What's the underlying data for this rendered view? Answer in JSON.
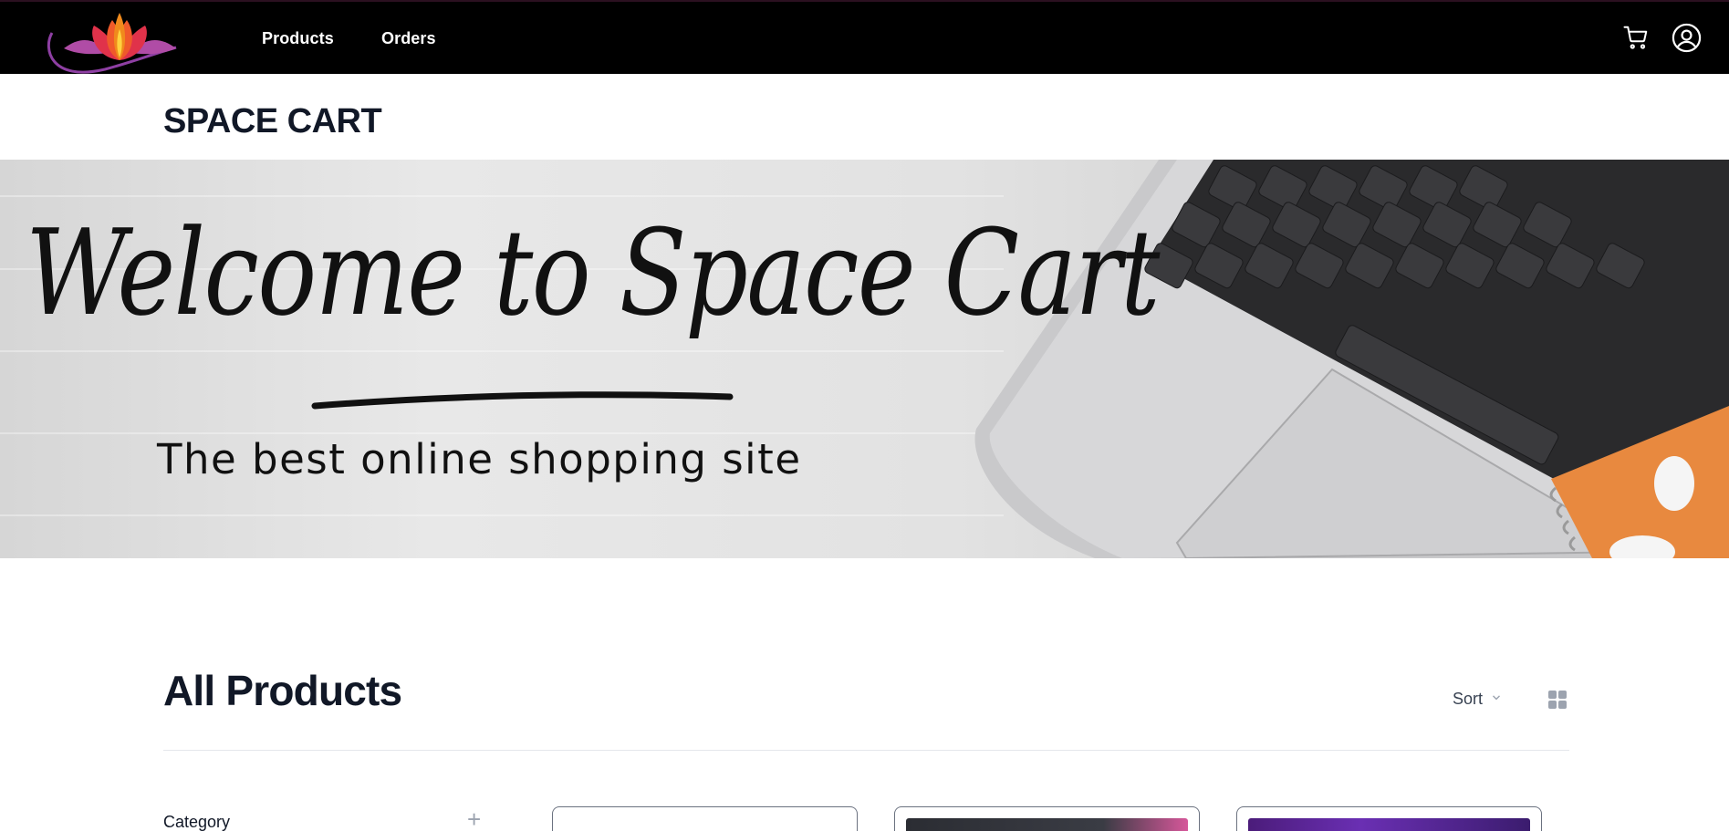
{
  "nav": {
    "logo": "lotus-logo",
    "links": [
      "Products",
      "Orders"
    ],
    "icons": [
      "cart-icon",
      "user-account-icon"
    ]
  },
  "brand": {
    "title": "SPACE CART"
  },
  "banner": {
    "headline": "Welcome to Space Cart",
    "subtitle": "The best online shopping site"
  },
  "products": {
    "title": "All Products",
    "sort_label": "Sort",
    "grid_icon": "grid-view-icon"
  },
  "filters": {
    "category_label": "Category",
    "expand_symbol": "+"
  },
  "colors": {
    "navbar_bg": "#000000",
    "text_dark": "#111827",
    "lotus_purple": "#8e3fa3",
    "lotus_orange": "#f08a1c",
    "lotus_red": "#e0324a"
  }
}
